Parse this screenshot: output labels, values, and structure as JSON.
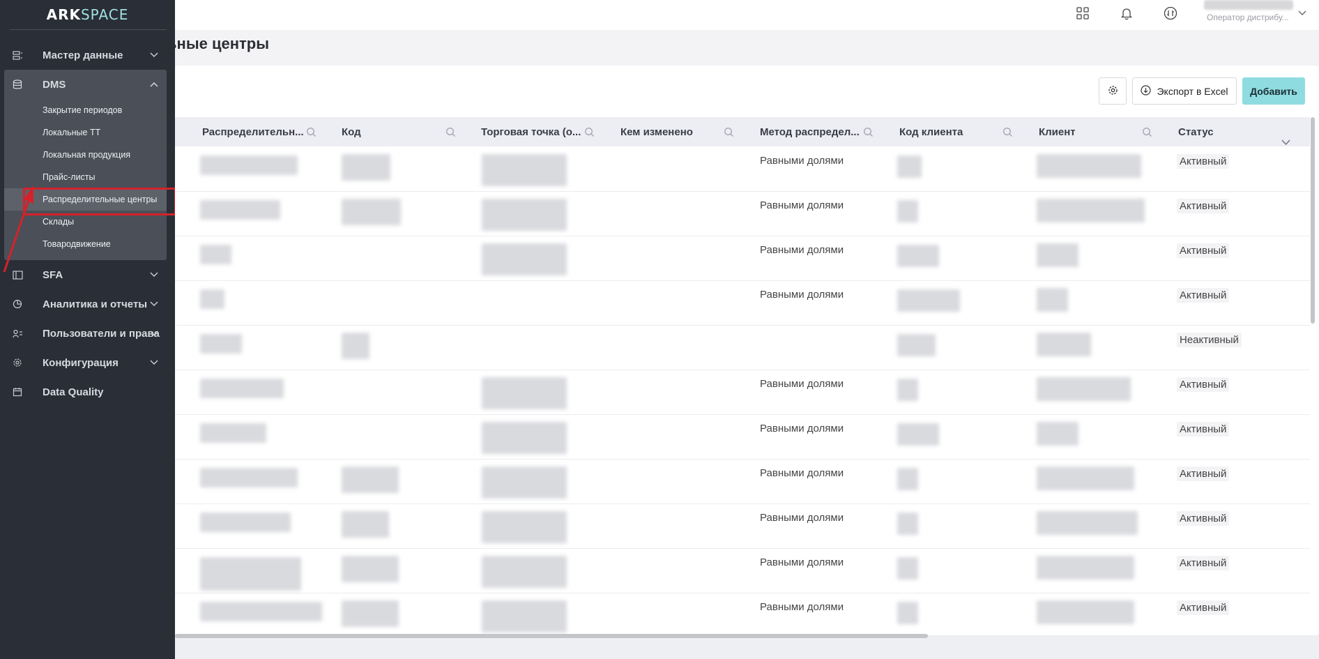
{
  "app": {
    "logo_part1": "ARK",
    "logo_part2": "SPACE"
  },
  "sidebar": {
    "items": [
      {
        "label": "Мастер данные",
        "icon": "master-data-icon"
      },
      {
        "label": "DMS",
        "icon": "database-icon",
        "expanded": true,
        "children": [
          "Закрытие периодов",
          "Локальные ТТ",
          "Локальная продукция",
          "Прайс-листы",
          "Распределительные центры",
          "Склады",
          "Товародвижение"
        ],
        "active_child": "Распределительные центры"
      },
      {
        "label": "SFA",
        "icon": "sfa-icon"
      },
      {
        "label": "Аналитика и отчеты",
        "icon": "analytics-icon"
      },
      {
        "label": "Пользователи и права",
        "icon": "users-icon"
      },
      {
        "label": "Конфигурация",
        "icon": "gear-icon"
      },
      {
        "label": "Data Quality",
        "icon": "calendar-icon"
      }
    ]
  },
  "topbar": {
    "icons": [
      "apps-grid-icon",
      "bell-icon",
      "sync-icon"
    ],
    "user_role": "Оператор дистрибу..."
  },
  "page": {
    "title": "ьные центры"
  },
  "toolbar": {
    "export_label": "Экспорт в Excel",
    "add_label": "Добавить"
  },
  "table": {
    "columns": [
      "Распределительн...",
      "Код",
      "Торговая точка (о...",
      "Кем изменено",
      "Метод распредел...",
      "Код клиента",
      "Клиент",
      "Статус"
    ],
    "rows": [
      {
        "method": "Равными долями",
        "status": "Активный"
      },
      {
        "method": "Равными долями",
        "status": "Активный"
      },
      {
        "method": "Равными долями",
        "status": "Активный"
      },
      {
        "method": "Равными долями",
        "status": "Активный"
      },
      {
        "method": "",
        "status": "Неактивный"
      },
      {
        "method": "Равными долями",
        "status": "Активный"
      },
      {
        "method": "Равными долями",
        "status": "Активный"
      },
      {
        "method": "Равными долями",
        "status": "Активный"
      },
      {
        "method": "Равными долями",
        "status": "Активный"
      },
      {
        "method": "Равными долями",
        "status": "Активный"
      },
      {
        "method": "Равными долями",
        "status": "Активный"
      }
    ]
  }
}
